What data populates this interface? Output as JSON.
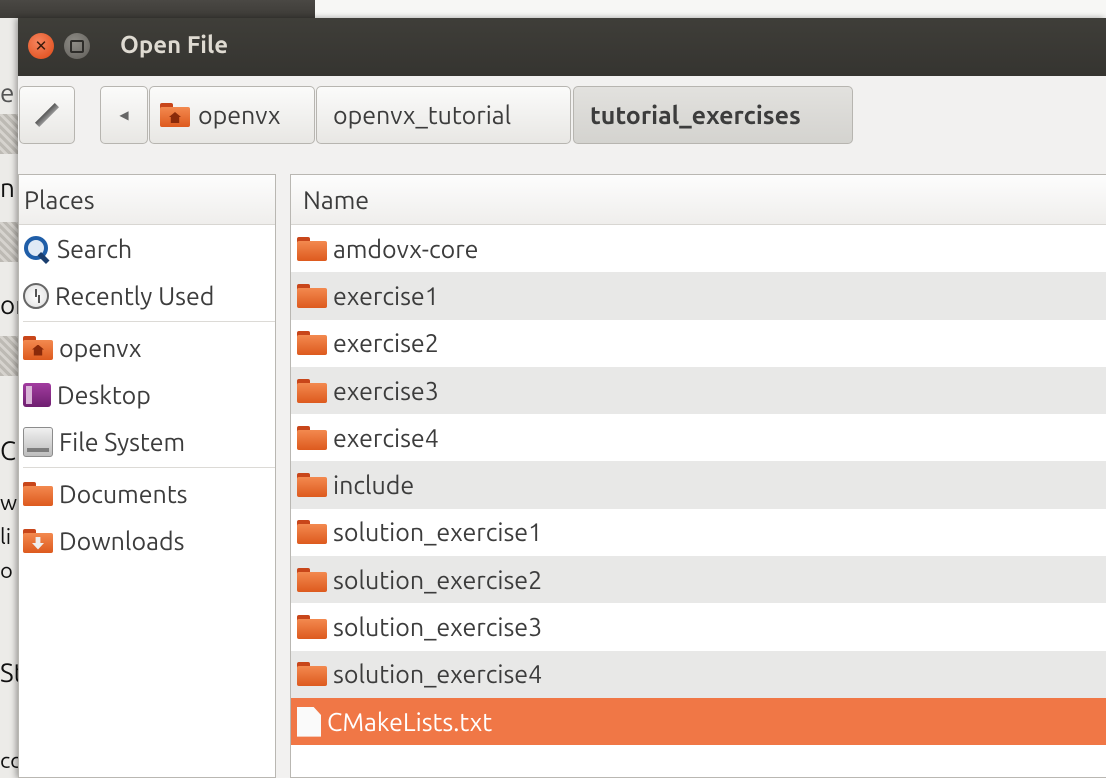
{
  "background": {
    "glyphs": [
      "e",
      "n",
      "or",
      "C",
      "w",
      "li",
      "o",
      "St",
      "cc"
    ]
  },
  "dialog": {
    "title": "Open File",
    "pathbar": {
      "crumbs": [
        "openvx",
        "openvx_tutorial",
        "tutorial_exercises"
      ],
      "back_glyph": "◀"
    },
    "places": {
      "header": "Places",
      "items": [
        {
          "label": "Search",
          "icon": "search-icon"
        },
        {
          "label": "Recently Used",
          "icon": "clock-icon"
        },
        {
          "label": "openvx",
          "icon": "home-folder-icon"
        },
        {
          "label": "Desktop",
          "icon": "desktop-icon"
        },
        {
          "label": "File System",
          "icon": "drive-icon"
        },
        {
          "label": "Documents",
          "icon": "folder-icon"
        },
        {
          "label": "Downloads",
          "icon": "downloads-folder-icon"
        }
      ]
    },
    "files": {
      "header": "Name",
      "items": [
        {
          "name": "amdovx-core",
          "type": "folder"
        },
        {
          "name": "exercise1",
          "type": "folder"
        },
        {
          "name": "exercise2",
          "type": "folder"
        },
        {
          "name": "exercise3",
          "type": "folder"
        },
        {
          "name": "exercise4",
          "type": "folder"
        },
        {
          "name": "include",
          "type": "folder"
        },
        {
          "name": "solution_exercise1",
          "type": "folder"
        },
        {
          "name": "solution_exercise2",
          "type": "folder"
        },
        {
          "name": "solution_exercise3",
          "type": "folder"
        },
        {
          "name": "solution_exercise4",
          "type": "folder"
        },
        {
          "name": "CMakeLists.txt",
          "type": "file",
          "selected": true
        }
      ]
    }
  },
  "colors": {
    "accent": "#f07746",
    "titlebar": "#3c3b37",
    "close_button": "#e95420"
  }
}
